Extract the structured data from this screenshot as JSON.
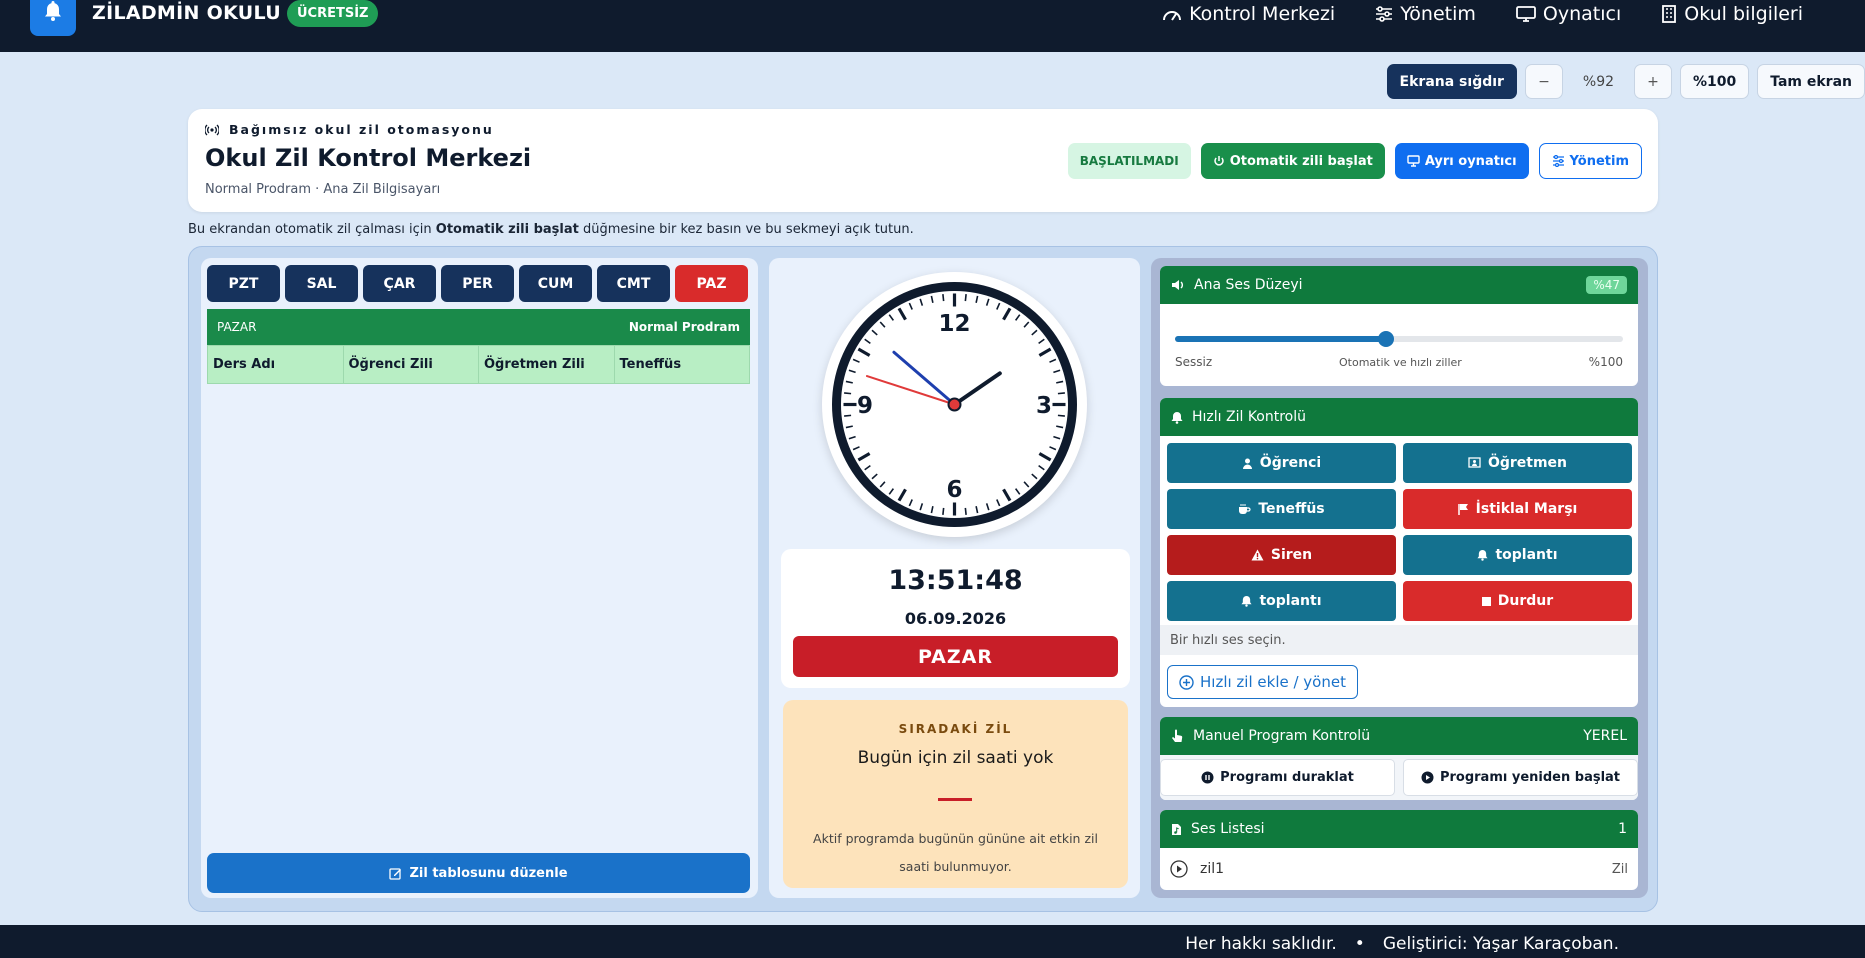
{
  "topbar": {
    "brand": "ZİLADMİN OKULU",
    "badge": "ÜCRETSİZ",
    "nav": [
      "Kontrol Merkezi",
      "Yönetim",
      "Oynatıcı",
      "Okul bilgileri"
    ]
  },
  "zoom": {
    "fit": "Ekrana sığdır",
    "minus": "−",
    "level": "%92",
    "plus": "+",
    "reset": "%100",
    "fullscreen": "Tam ekran"
  },
  "header": {
    "subtitle": "Bağımsız okul zil otomasyonu",
    "title": "Okul Zil Kontrol Merkezi",
    "meta": "Normal Prodram · Ana Zil Bilgisayarı",
    "status": "BAŞLATILMADI",
    "start": "Otomatik zili başlat",
    "player": "Ayrı oynatıcı",
    "admin": "Yönetim"
  },
  "note": {
    "pre": "Bu ekrandan otomatik zil çalması için ",
    "bold": "Otomatik zili başlat",
    "post": " düğmesine bir kez basın ve bu sekmeyi açık tutun."
  },
  "days": [
    "PZT",
    "SAL",
    "ÇAR",
    "PER",
    "CUM",
    "CMT",
    "PAZ"
  ],
  "schedule": {
    "day": "PAZAR",
    "program": "Normal Prodram",
    "columns": [
      "Ders Adı",
      "Öğrenci Zili",
      "Öğretmen Zili",
      "Teneffüs"
    ],
    "edit": "Zil tablosunu düzenle"
  },
  "clock": {
    "numbers": [
      "12",
      "3",
      "6",
      "9"
    ],
    "time": "13:51:48",
    "date": "06.09.2026",
    "day": "PAZAR",
    "hour": 13,
    "minute": 51,
    "second": 48
  },
  "next": {
    "label": "SIRADAKİ ZİL",
    "title": "Bugün için zil saati yok",
    "desc": "Aktif programda bugünün gününe ait etkin zil saati bulunmuyor."
  },
  "volume": {
    "title": "Ana Ses Düzeyi",
    "percent": "%47",
    "value": 47,
    "min": "Sessiz",
    "mid": "Otomatik ve hızlı ziller",
    "max": "%100"
  },
  "quick": {
    "title": "Hızlı Zil Kontrolü",
    "buttons": [
      "Öğrenci",
      "Öğretmen",
      "Teneffüs",
      "İstiklal Marşı",
      "Siren",
      "toplantı",
      "toplantı",
      "Durdur"
    ],
    "status": "Bir hızlı ses seçin.",
    "add": "Hızlı zil ekle / yönet"
  },
  "manual": {
    "title": "Manuel Program Kontrolü",
    "tag": "YEREL",
    "pause": "Programı duraklat",
    "restart": "Programı yeniden başlat"
  },
  "sounds": {
    "title": "Ses Listesi",
    "count": "1",
    "items": [
      {
        "name": "zil1",
        "tag": "Zil"
      }
    ]
  },
  "footer": {
    "rights": "Her hakkı saklıdır.",
    "sep": "•",
    "dev": "Geliştirici: Yaşar Karaçoban."
  },
  "colors": {
    "navy": "#0f1b2d",
    "green": "#198f4b",
    "red": "#d92b2b",
    "blue": "#0f6ef0",
    "teal": "#14718f"
  }
}
